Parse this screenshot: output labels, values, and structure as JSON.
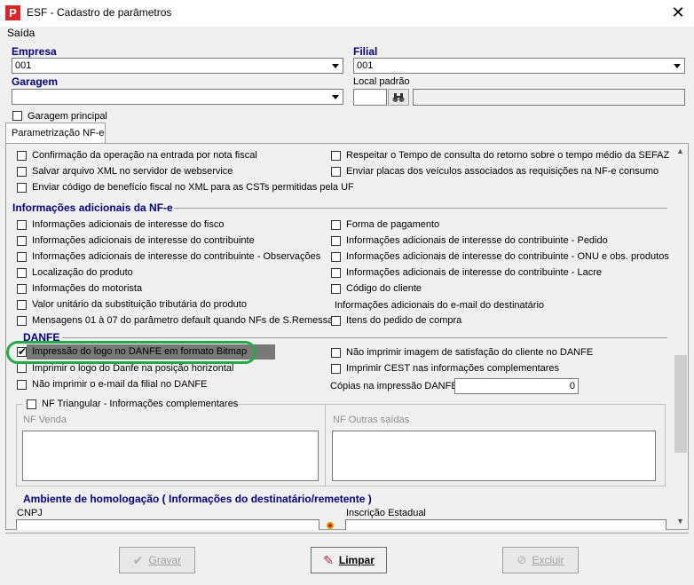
{
  "window": {
    "title": "ESF - Cadastro de parâmetros",
    "close_glyph": "✕",
    "app_icon_glyph": "P"
  },
  "menu": {
    "item": "Saída"
  },
  "empresa": {
    "label": "Empresa",
    "value": "001"
  },
  "filial": {
    "label": "Filial",
    "value": "001"
  },
  "garagem": {
    "label": "Garagem",
    "value": ""
  },
  "local_padrao": {
    "label": "Local padrão",
    "value": ""
  },
  "garagem_principal": {
    "label": "Garagem principal",
    "checked": false
  },
  "tab": {
    "label": "Parametrização NF-e"
  },
  "top_checks": {
    "left": [
      "Confirmação da operação na entrada por nota fiscal",
      "Salvar arquivo XML no servidor de webservice",
      "Enviar código de benefício fiscal no XML para as CSTs permitidas pela UF"
    ],
    "right": [
      "Respeitar o Tempo de consulta do retorno sobre o tempo médio da SEFAZ",
      "Enviar placas dos veículos associados as requisições na NF-e consumo"
    ]
  },
  "info_adicionais": {
    "title": "Informações adicionais da NF-e",
    "left": [
      "Informações adicionais de interesse do fisco",
      "Informações adicionais de interesse do contribuinte",
      "Informações adicionais de interesse do contribuinte - Observações",
      "Localização do produto",
      "Informações do motorista",
      "Valor unitário da substituição tributária do produto",
      "Mensagens 01 à 07 do parâmetro default quando NFs de S.Remessa"
    ],
    "right": [
      "Forma de pagamento",
      "Informações adicionais de interesse do contribuinte - Pedido",
      "Informações adicionais de interesse do contribuinte - ONU e obs. produtos",
      "Informações adicionais de interesse do contribuinte - Lacre",
      "Código do cliente"
    ],
    "email_label": "Informações adicionais do e-mail do destinatário",
    "itens_pedido": "Itens do pedido de compra"
  },
  "danfe": {
    "title": "DANFE",
    "logo_bitmap": "Impressão do logo no DANFE em formato Bitmap",
    "logo_horizontal": "Imprimir o logo do Danfe na posição horizontal",
    "email_filial": "Não imprimir o e-mail da filial no DANFE",
    "satisfacao": "Não imprimir imagem de satisfação do cliente no DANFE",
    "cest": "Imprimir CEST nas informações complementares",
    "copias_label": "Cópias na impressão DANFE",
    "copias_value": "0"
  },
  "nf_triangular": {
    "label": "NF Triangular - Informações complementares",
    "venda_label": "NF Venda",
    "outras_label": "NF Outras saídas"
  },
  "homologacao": {
    "title": "Ambiente de homologação ( Informações do destinatário/remetente )",
    "cnpj_label": "CNPJ",
    "ie_label": "Inscrição Estadual"
  },
  "buttons": {
    "gravar": {
      "label": "Gravar",
      "enabled": false
    },
    "limpar": {
      "label": "Limpar",
      "enabled": true
    },
    "excluir": {
      "label": "Excluir",
      "enabled": false
    }
  },
  "colors": {
    "section_title": "#000080",
    "highlight": "#22aa44"
  }
}
